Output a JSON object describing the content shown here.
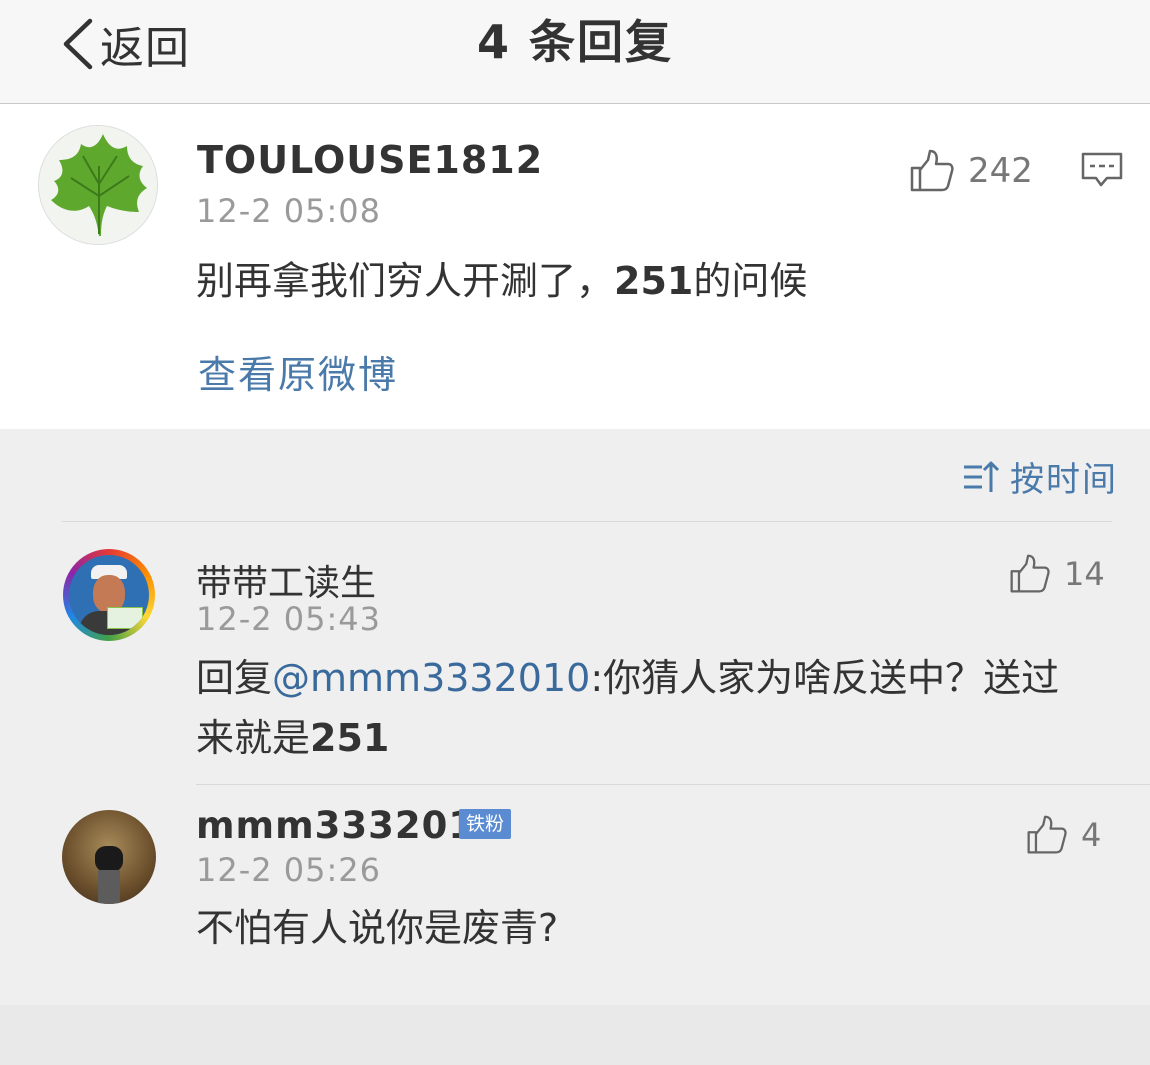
{
  "nav": {
    "back_label": "返回",
    "title": "4 条回复"
  },
  "main_comment": {
    "username": "TOULOUSE1812",
    "time": "12-2 05:08",
    "text_a": "别再拿我们穷人开涮了，",
    "text_b": "251",
    "text_c": "的问候",
    "likes": "242",
    "view_original": "查看原微博"
  },
  "sort": {
    "label": "按时间"
  },
  "replies": [
    {
      "username": "带带工读生",
      "time": "12-2 05:43",
      "prefix": "回复",
      "mention": "@mmm3332010",
      "text_line1": ":你猜人家为啥反送中？送过",
      "text_line2a": "来就是",
      "text_line2b": "251",
      "likes": "14"
    },
    {
      "username": "mmm3332010",
      "badge": "铁粉",
      "time": "12-2 05:26",
      "text": "不怕有人说你是废青?",
      "likes": "4"
    }
  ],
  "icons": {
    "back": "chevron-left-icon",
    "like": "thumbs-up-icon",
    "comment": "comment-icon",
    "sort": "sort-icon"
  },
  "colors": {
    "link": "#4a7aaa",
    "badge": "#5b8bd1"
  }
}
